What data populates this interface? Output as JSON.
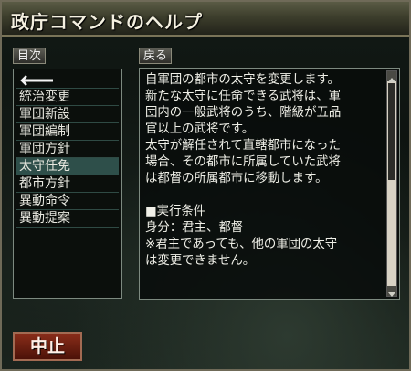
{
  "window": {
    "title": "政庁コマンドのヘルプ"
  },
  "tabs": {
    "contents": "目次",
    "back": "戻る"
  },
  "list": {
    "items": [
      "",
      "統治変更",
      "軍団新設",
      "軍団編制",
      "軍団方針",
      "太守任免",
      "都市方針",
      "異動命令",
      "異動提案"
    ],
    "selected_index": 5
  },
  "help": {
    "lines": [
      "自軍団の都市の太守を変更します。",
      "新たな太守に任命できる武将は、軍",
      "団内の一般武将のうち、階級が五品",
      "官以上の武将です。",
      "太守が解任されて直轄都市になった",
      "場合、その都市に所属していた武将",
      "は都督の所属都市に移動します。",
      "",
      "■実行条件",
      "身分：君主、都督",
      "※君主であっても、他の軍団の太守",
      "は変更できません。"
    ]
  },
  "buttons": {
    "cancel": "中止"
  },
  "icons": {
    "list_back": "return-arrow-icon"
  }
}
